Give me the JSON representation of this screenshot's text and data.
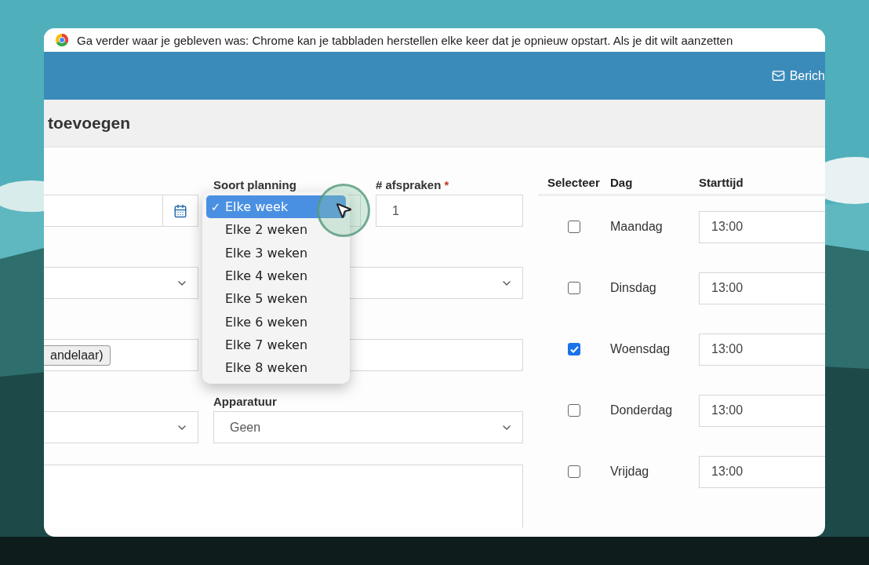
{
  "banner": {
    "text": "Ga verder waar je gebleven was: Chrome kan je tabbladen herstellen elke keer dat je opnieuw opstart. Als je dit wilt aanzetten"
  },
  "top_bar": {
    "link": "Berich"
  },
  "page_title": "toevoegen",
  "form": {
    "soort_planning": {
      "label": "Soort planning"
    },
    "afspraken": {
      "label": "# afspraken",
      "required_mark": "*",
      "value": "1"
    },
    "row3_chip": "andelaar)",
    "apparatuur": {
      "label": "Apparatuur",
      "value": "Geen"
    }
  },
  "dropdown": {
    "check": "✓",
    "options": [
      {
        "label": "Elke week",
        "selected": true
      },
      {
        "label": "Elke 2 weken",
        "selected": false
      },
      {
        "label": "Elke 3 weken",
        "selected": false
      },
      {
        "label": "Elke 4 weken",
        "selected": false
      },
      {
        "label": "Elke 5 weken",
        "selected": false
      },
      {
        "label": "Elke 6 weken",
        "selected": false
      },
      {
        "label": "Elke 7 weken",
        "selected": false
      },
      {
        "label": "Elke 8 weken",
        "selected": false
      }
    ]
  },
  "table": {
    "columns": [
      "Selecteer",
      "Dag",
      "Starttijd"
    ],
    "rows": [
      {
        "day": "Maandag",
        "checked": false,
        "time": "13:00"
      },
      {
        "day": "Dinsdag",
        "checked": false,
        "time": "13:00"
      },
      {
        "day": "Woensdag",
        "checked": true,
        "time": "13:00"
      },
      {
        "day": "Donderdag",
        "checked": false,
        "time": "13:00"
      },
      {
        "day": "Vrijdag",
        "checked": false,
        "time": "13:00"
      }
    ]
  }
}
